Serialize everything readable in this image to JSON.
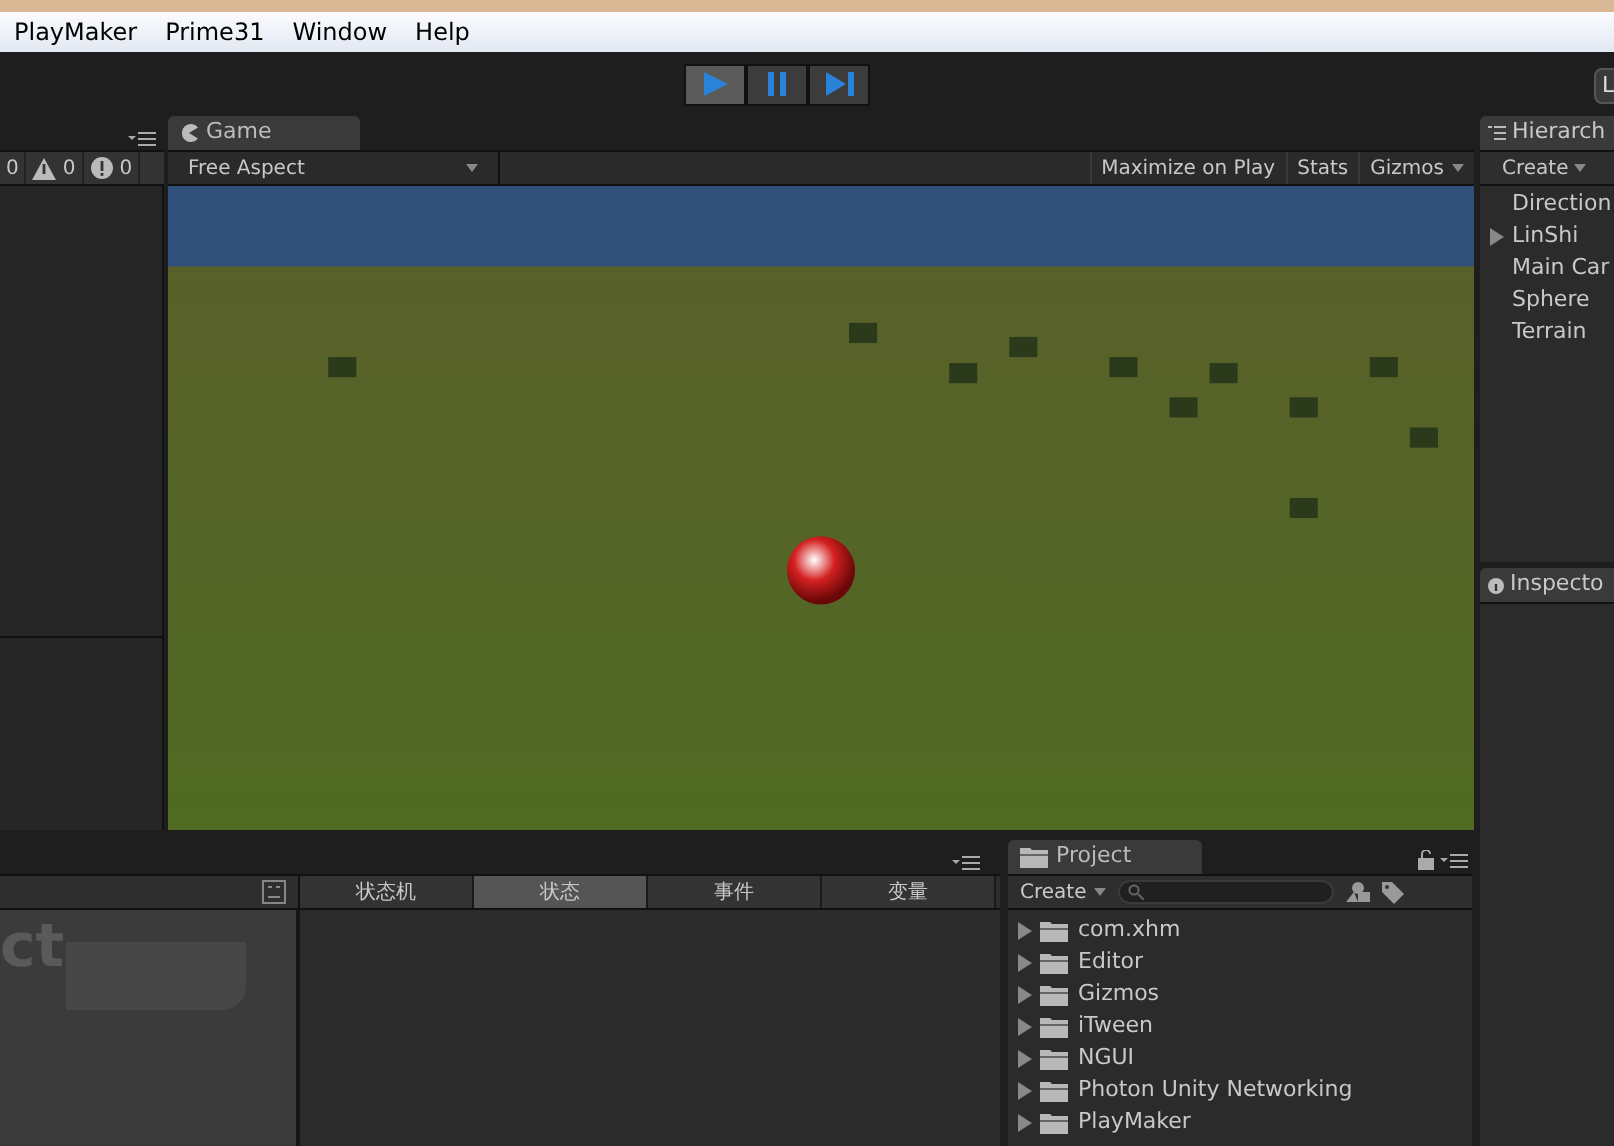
{
  "menu_bar": {
    "items": [
      "PlayMaker",
      "Prime31",
      "Window",
      "Help"
    ]
  },
  "toolbar": {
    "play_controls": [
      {
        "kind": "play",
        "selected": true
      },
      {
        "kind": "pause",
        "selected": false
      },
      {
        "kind": "step",
        "selected": false
      }
    ],
    "layers_button": "L"
  },
  "console": {
    "counts": [
      {
        "kind": "info",
        "value": "0"
      },
      {
        "kind": "warning",
        "value": "0"
      },
      {
        "kind": "error",
        "value": "0"
      }
    ]
  },
  "game": {
    "tab": "Game",
    "aspect": "Free Aspect",
    "buttons": [
      {
        "label": "Maximize on Play",
        "dropdown": false
      },
      {
        "label": "Stats",
        "dropdown": false
      },
      {
        "label": "Gizmos",
        "dropdown": true
      }
    ]
  },
  "hierarchy": {
    "tab": "Hierarch",
    "create": "Create",
    "items": [
      {
        "label": "Direction",
        "has_children": false
      },
      {
        "label": "LinShi",
        "has_children": true
      },
      {
        "label": "Main Car",
        "has_children": false
      },
      {
        "label": "Sphere",
        "has_children": false
      },
      {
        "label": "Terrain",
        "has_children": false
      }
    ]
  },
  "inspector": {
    "tab": "Inspecto"
  },
  "playmaker": {
    "logo_text": "ct",
    "tabs": [
      {
        "label": "状态机",
        "selected": false
      },
      {
        "label": "状态",
        "selected": true
      },
      {
        "label": "事件",
        "selected": false
      },
      {
        "label": "变量",
        "selected": false
      }
    ]
  },
  "project": {
    "tab": "Project",
    "create": "Create",
    "folders": [
      "com.xhm",
      "Editor",
      "Gizmos",
      "iTween",
      "NGUI",
      "Photon Unity Networking",
      "PlayMaker"
    ]
  }
}
